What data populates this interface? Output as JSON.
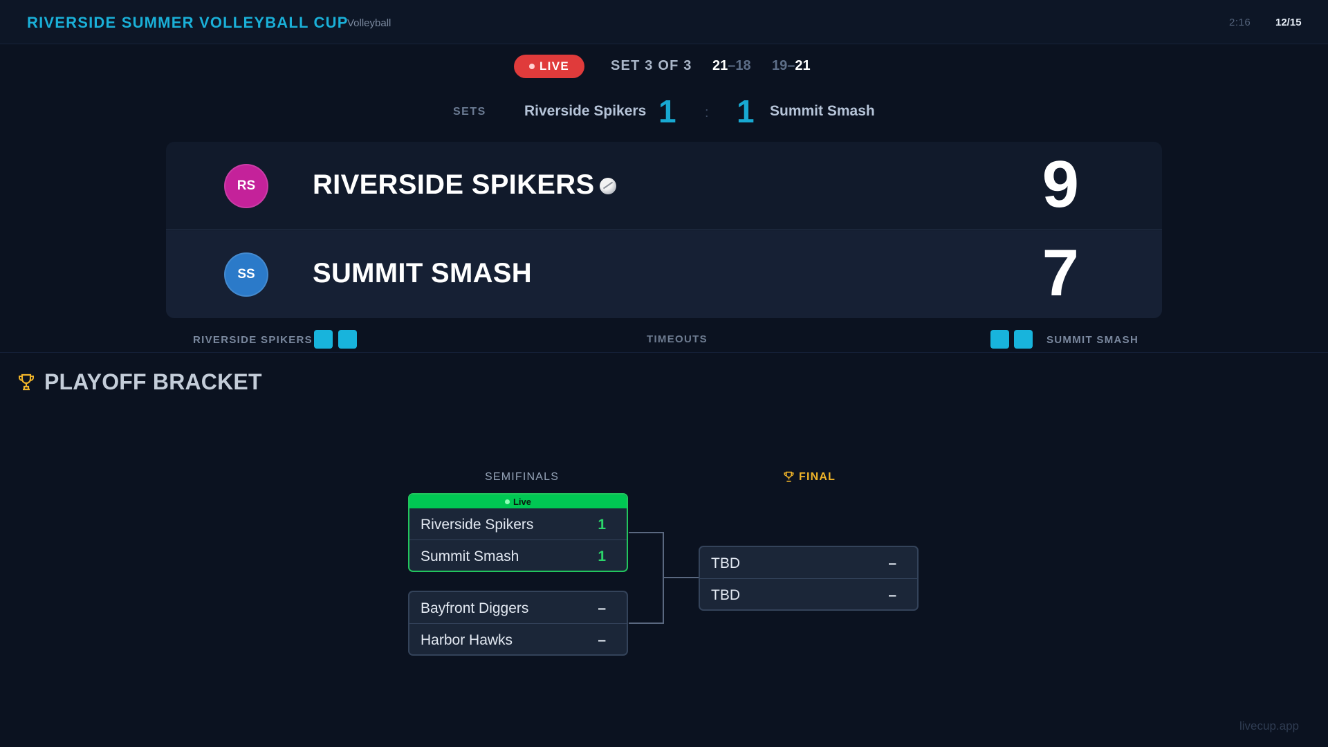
{
  "header": {
    "title": "RIVERSIDE SUMMER VOLLEYBALL CUP",
    "sport": "Volleyball",
    "clock": "2:16",
    "date": "12/15"
  },
  "live_status": {
    "badge": "LIVE",
    "set_label": "SET 3 OF 3",
    "set_scores": [
      {
        "home": "21",
        "sep": "–",
        "away": "18"
      },
      {
        "home": "19",
        "sep": "–",
        "away": "21"
      }
    ]
  },
  "sets": {
    "label": "SETS",
    "home_name": "Riverside Spikers",
    "home_sets": "1",
    "separator": ":",
    "away_sets": "1",
    "away_name": "Summit Smash"
  },
  "scoreboard": {
    "home": {
      "initials": "RS",
      "name": "RIVERSIDE SPIKERS",
      "score": "9",
      "color": "#c4229a",
      "serving": true
    },
    "away": {
      "initials": "SS",
      "name": "SUMMIT SMASH",
      "score": "7",
      "color": "#2b7ac9",
      "serving": false
    }
  },
  "timeouts": {
    "label": "TIMEOUTS",
    "home_name": "RIVERSIDE SPIKERS",
    "away_name": "SUMMIT SMASH",
    "home_remaining": 2,
    "away_remaining": 2
  },
  "bracket": {
    "title": "PLAYOFF BRACKET",
    "semis_label": "SEMIFINALS",
    "final_label": "FINAL",
    "semi1": {
      "status": "Live",
      "teams": [
        {
          "name": "Riverside Spikers",
          "score": "1"
        },
        {
          "name": "Summit Smash",
          "score": "1"
        }
      ]
    },
    "semi2": {
      "teams": [
        {
          "name": "Bayfront Diggers",
          "score": "–"
        },
        {
          "name": "Harbor Hawks",
          "score": "–"
        }
      ]
    },
    "final": {
      "teams": [
        {
          "name": "TBD",
          "score": "–"
        },
        {
          "name": "TBD",
          "score": "–"
        }
      ]
    }
  },
  "footer": {
    "site": "livecup.app"
  },
  "colors": {
    "accent": "#1ab0d8",
    "live": "#e03b3b",
    "live_green": "#22c55e",
    "final_gold": "#f0b429"
  }
}
